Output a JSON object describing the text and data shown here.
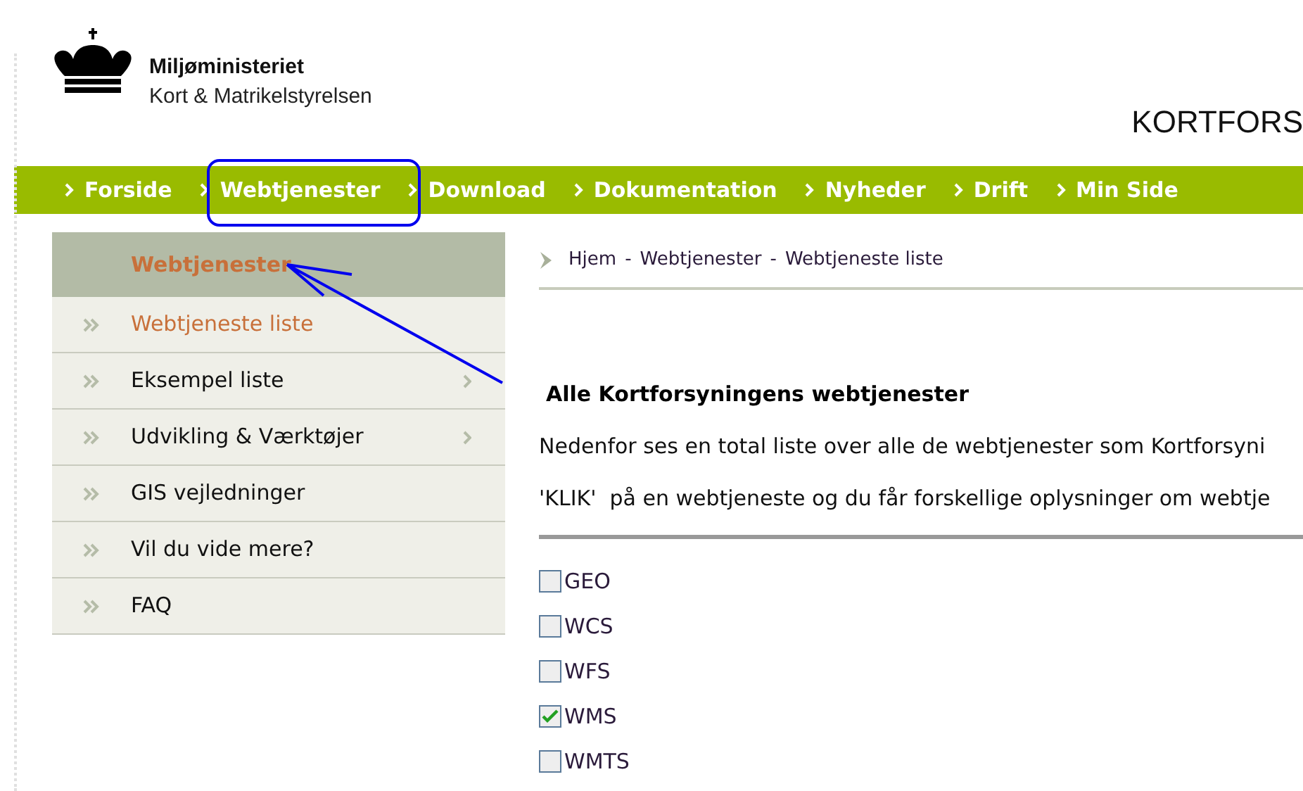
{
  "header": {
    "ministry": "Miljøministeriet",
    "agency": "Kort & Matrikelstyrelsen",
    "site_title": "KORTFORS"
  },
  "nav": [
    {
      "label": "Forside"
    },
    {
      "label": "Webtjenester"
    },
    {
      "label": "Download"
    },
    {
      "label": "Dokumentation"
    },
    {
      "label": "Nyheder"
    },
    {
      "label": "Drift"
    },
    {
      "label": "Min Side"
    }
  ],
  "sidebar": {
    "heading": "Webtjenester",
    "items": [
      {
        "label": "Webtjeneste liste",
        "selected": true,
        "has_submenu": false
      },
      {
        "label": "Eksempel liste",
        "selected": false,
        "has_submenu": true
      },
      {
        "label": "Udvikling & Værktøjer",
        "selected": false,
        "has_submenu": true
      },
      {
        "label": "GIS vejledninger",
        "selected": false,
        "has_submenu": false
      },
      {
        "label": "Vil du vide mere?",
        "selected": false,
        "has_submenu": false
      },
      {
        "label": "FAQ",
        "selected": false,
        "has_submenu": false
      }
    ]
  },
  "breadcrumb": {
    "separator": "-",
    "items": [
      "Hjem",
      "Webtjenester",
      "Webtjeneste liste"
    ]
  },
  "content": {
    "heading": "Alle Kortforsyningens webtjenester",
    "paragraphs": [
      "Nedenfor ses en total liste over alle de webtjenester som Kortforsyni",
      "'KLIK'  på en webtjeneste og du får forskellige oplysninger om webtje"
    ],
    "filters": [
      {
        "label": "GEO",
        "checked": false
      },
      {
        "label": "WCS",
        "checked": false
      },
      {
        "label": "WFS",
        "checked": false
      },
      {
        "label": "WMS",
        "checked": true
      },
      {
        "label": "WMTS",
        "checked": false
      }
    ]
  }
}
